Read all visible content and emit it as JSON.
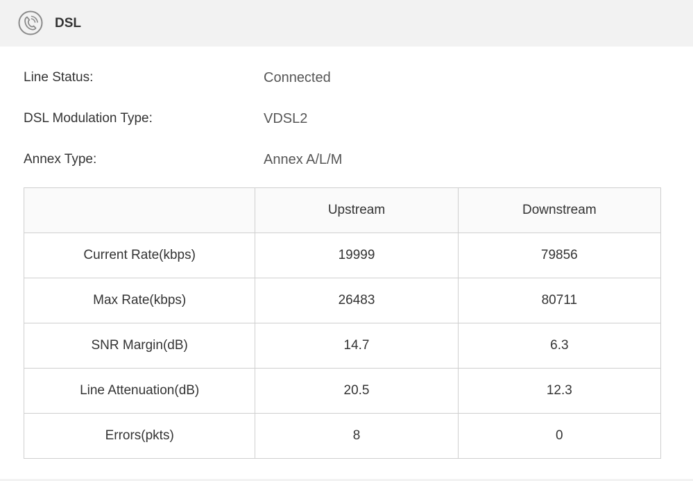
{
  "header": {
    "icon": "phone-handset-icon",
    "title": "DSL"
  },
  "info": [
    {
      "label": "Line Status:",
      "value": "Connected"
    },
    {
      "label": "DSL Modulation Type:",
      "value": "VDSL2"
    },
    {
      "label": "Annex Type:",
      "value": "Annex A/L/M"
    }
  ],
  "table": {
    "headers": [
      "",
      "Upstream",
      "Downstream"
    ],
    "rows": [
      {
        "label": "Current Rate(kbps)",
        "upstream": "19999",
        "downstream": "79856"
      },
      {
        "label": "Max Rate(kbps)",
        "upstream": "26483",
        "downstream": "80711"
      },
      {
        "label": "SNR Margin(dB)",
        "upstream": "14.7",
        "downstream": "6.3"
      },
      {
        "label": "Line Attenuation(dB)",
        "upstream": "20.5",
        "downstream": "12.3"
      },
      {
        "label": "Errors(pkts)",
        "upstream": "8",
        "downstream": "0"
      }
    ]
  },
  "colors": {
    "header_bg": "#f2f2f2",
    "border": "#cfcfcf",
    "text": "#333333",
    "value_text": "#555555"
  }
}
